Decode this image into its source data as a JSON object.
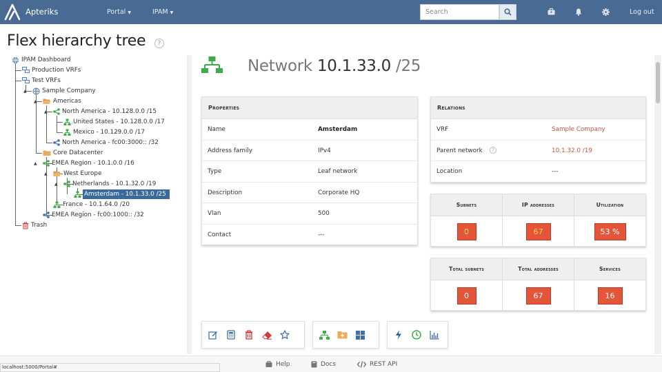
{
  "header": {
    "brand": "Apteriks",
    "portal_label": "Portal",
    "ipam_label": "IPAM",
    "search_placeholder": "Search",
    "logout_label": "Log out"
  },
  "page": {
    "title": "Flex hierarchy tree"
  },
  "tree": {
    "root": "IPAM Dashboard",
    "production_vrfs": "Production VRFs",
    "test_vrfs": "Test VRFs",
    "sample_company": "Sample Company",
    "americas": "Americas",
    "north_america_v4": "North America - 10.128.0.0 /15",
    "united_states": "United States - 10.128.0.0 /17",
    "mexico": "Mexico - 10.129.0.0 /17",
    "north_america_v6": "North America - fc00:3000:: /32",
    "core_datacenter": "Core Datacenter",
    "emea_v4": "EMEA Region - 10.1.0.0 /16",
    "west_europe": "West Europe",
    "netherlands": "Netherlands - 10.1.32.0 /19",
    "amsterdam": "Amsterdam - 10.1.33.0 /25",
    "france": "France - 10.1.64.0 /20",
    "emea_v6": "EMEA Region - fc00:1000:: /32",
    "trash": "Trash"
  },
  "network": {
    "prefix_label": "Network",
    "address": "10.1.33.0",
    "mask": " /25"
  },
  "properties": {
    "title": "Properties",
    "rows": [
      {
        "label": "Name",
        "value": "Amsterdam"
      },
      {
        "label": "Address family",
        "value": "IPv4"
      },
      {
        "label": "Type",
        "value": "Leaf network"
      },
      {
        "label": "Description",
        "value": "Corporate HQ"
      },
      {
        "label": "Vlan",
        "value": "500"
      },
      {
        "label": "Contact",
        "value": "---"
      }
    ]
  },
  "relations": {
    "title": "Relations",
    "vrf_label": "VRF",
    "vrf_value": "Sample Company",
    "parent_label": "Parent network",
    "parent_value": "10.1.32.0 /19",
    "location_label": "Location",
    "location_value": "---"
  },
  "stats1": {
    "subnets_label": "Subnets",
    "subnets": "0",
    "ip_label": "IP addresses",
    "ip": "67",
    "util_label": "Utilization",
    "util": "53 %"
  },
  "stats2": {
    "total_subnets_label": "Total subnets",
    "total_subnets": "0",
    "total_addresses_label": "Total addresses",
    "total_addresses": "67",
    "services_label": "Services",
    "services": "16"
  },
  "footer": {
    "help": "Help",
    "docs": "Docs",
    "api": "REST API",
    "status_url": "localhost:5000/Portal#"
  },
  "colors": {
    "navbar": "#496a93",
    "badge": "#e4553a",
    "network_green": "#3cae49",
    "link": "#c0563a",
    "selected": "#3a6a9b"
  }
}
